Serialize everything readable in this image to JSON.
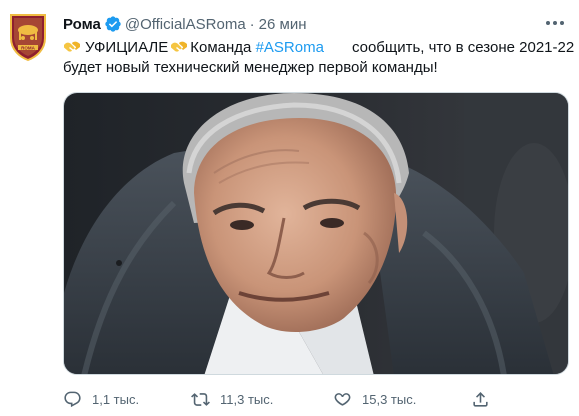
{
  "tweet": {
    "author_name": "Рома",
    "handle": "@OfficialASRoma",
    "separator": "·",
    "time": "26 мин",
    "text_line1_before": "УФИЦИАЛЕ",
    "text_line1_middle": "Команда ",
    "hashtag": "#ASRoma",
    "text_line1_after": "сообщить, что в сезоне 2021-22",
    "text_line2": "будет новый технический менеджер первой команды!"
  },
  "actions": {
    "replies": "1,1 тыс.",
    "retweets": "11,3 тыс.",
    "likes": "15,3 тыс."
  },
  "icons": {
    "verified": "verified-badge-icon",
    "more": "more-options-icon",
    "hand": "handshake-emoji-icon",
    "reply": "reply-icon",
    "retweet": "retweet-icon",
    "like": "heart-icon",
    "share": "share-icon"
  },
  "colors": {
    "accent": "#1d9bf0",
    "secondary_text": "#536471",
    "roma_red": "#8e1f2f",
    "roma_gold": "#f0bc42"
  }
}
